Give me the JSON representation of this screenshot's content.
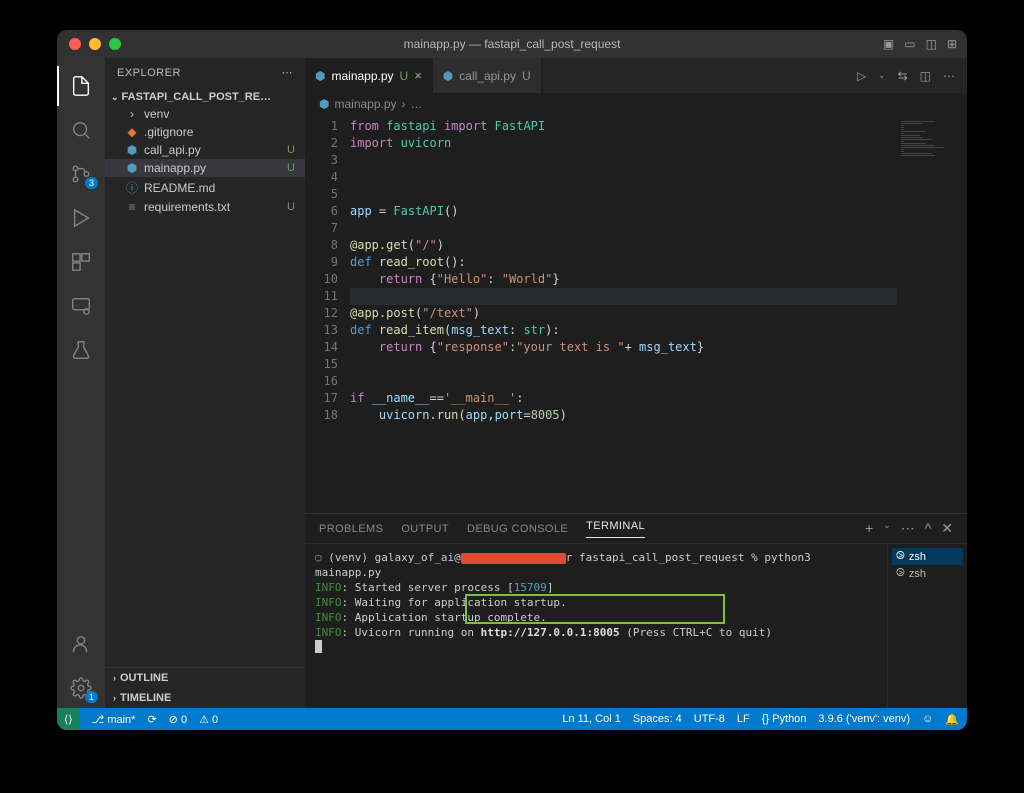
{
  "window": {
    "title": "mainapp.py — fastapi_call_post_request"
  },
  "sidebar": {
    "header": "EXPLORER",
    "project": "FASTAPI_CALL_POST_RE…",
    "items": [
      {
        "name": "venv",
        "icon": "folder",
        "status": ""
      },
      {
        "name": ".gitignore",
        "icon": "git",
        "status": ""
      },
      {
        "name": "call_api.py",
        "icon": "py",
        "status": "U"
      },
      {
        "name": "mainapp.py",
        "icon": "py",
        "status": "U",
        "selected": true
      },
      {
        "name": "README.md",
        "icon": "info",
        "status": ""
      },
      {
        "name": "requirements.txt",
        "icon": "txt",
        "status": "U"
      }
    ],
    "outline": "OUTLINE",
    "timeline": "TIMELINE"
  },
  "activity": {
    "scm_badge": "3",
    "settings_badge": "1"
  },
  "tabs": [
    {
      "label": "mainapp.py",
      "mod": "U",
      "active": true,
      "close": true
    },
    {
      "label": "call_api.py",
      "mod": "U",
      "active": false,
      "close": false
    }
  ],
  "breadcrumb": {
    "file": "mainapp.py",
    "sep": "›",
    "rest": "…"
  },
  "code": {
    "lines": [
      "<span class='k'>from</span> <span class='cls'>fastapi</span> <span class='k'>import</span> <span class='cls'>FastAPI</span>",
      "<span class='k'>import</span> <span class='cls'>uvicorn</span>",
      "",
      "",
      "",
      "<span class='var'>app</span> <span class='op'>=</span> <span class='cls'>FastAPI</span>()",
      "",
      "<span class='dec'>@app.get</span>(<span class='str'>\"/\"</span>)",
      "<span class='kw2'>def</span> <span class='fn'>read_root</span>():",
      "    <span class='k'>return</span> {<span class='str'>\"Hello\"</span>: <span class='str'>\"World\"</span>}",
      "",
      "<span class='dec'>@app.post</span>(<span class='str'>\"/text\"</span>)",
      "<span class='kw2'>def</span> <span class='fn'>read_item</span>(<span class='var'>msg_text</span>: <span class='cls'>str</span>):",
      "    <span class='k'>return</span> {<span class='str'>\"response\"</span>:<span class='str'>\"your text is \"</span><span class='op'>+</span> <span class='var'>msg_text</span>}",
      "",
      "",
      "<span class='k'>if</span> <span class='var'>__name__</span><span class='op'>==</span><span class='str'>'__main__'</span>:",
      "    <span class='var'>uvicorn</span>.<span class='fn'>run</span>(<span class='var'>app</span>,<span class='var'>port</span><span class='op'>=</span><span class='num'>8005</span>)"
    ],
    "highlight_line": 11
  },
  "panel": {
    "tabs": {
      "problems": "PROBLEMS",
      "output": "OUTPUT",
      "debug": "DEBUG CONSOLE",
      "terminal": "TERMINAL"
    },
    "terminal": {
      "prompt_prefix": "(venv) galaxy_of_ai@",
      "prompt_suffix": "r fastapi_call_post_request % ",
      "cmd": "python3 mainapp.py",
      "lines": [
        {
          "tag": "INFO",
          "text": "Started server process [",
          "num": "15709",
          "tail": "]"
        },
        {
          "tag": "INFO",
          "text": "Waiting for application startup."
        },
        {
          "tag": "INFO",
          "text": "Application startup complete."
        },
        {
          "tag": "INFO",
          "text": "Uvicorn running on ",
          "bold": "http://127.0.0.1:8005",
          "tail": " (Press CTRL+C to quit)"
        }
      ]
    },
    "term_list": [
      "zsh",
      "zsh"
    ]
  },
  "status": {
    "branch": "main*",
    "sync": "⟳",
    "errors": "⊘ 0",
    "warnings": "⚠ 0",
    "cursor": "Ln 11, Col 1",
    "spaces": "Spaces: 4",
    "encoding": "UTF-8",
    "eol": "LF",
    "lang": "{} Python",
    "interp": "3.9.6 ('venv': venv)",
    "feedback": "☺",
    "bell": "🔔"
  }
}
